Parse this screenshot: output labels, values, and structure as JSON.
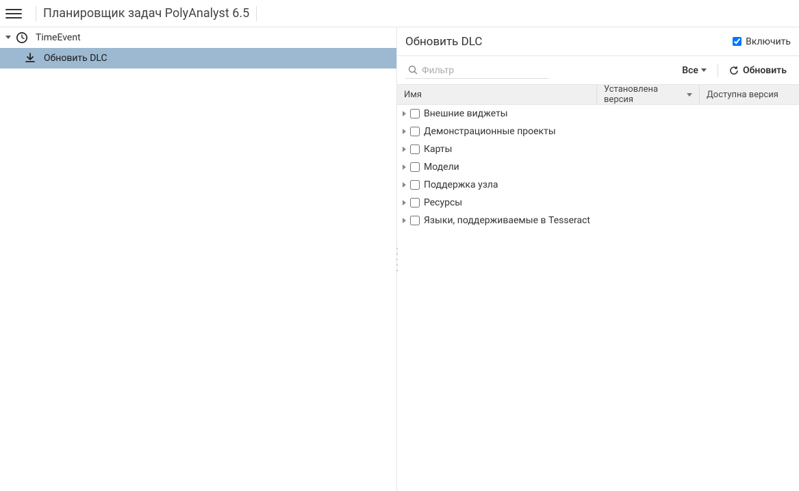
{
  "header": {
    "title": "Планировщик задач PolyAnalyst 6.5"
  },
  "tree": {
    "root_label": "TimeEvent",
    "child_label": "Обновить DLC"
  },
  "right": {
    "title": "Обновить DLC",
    "enable_label": "Включить",
    "filter_placeholder": "Фильтр",
    "all_label": "Все",
    "refresh_label": "Обновить",
    "columns": {
      "name": "Имя",
      "installed": "Установлена версия",
      "available": "Доступна версия"
    },
    "rows": [
      {
        "name": "Внешние виджеты"
      },
      {
        "name": "Демонстрационные проекты"
      },
      {
        "name": "Карты"
      },
      {
        "name": "Модели"
      },
      {
        "name": "Поддержка узла"
      },
      {
        "name": "Ресурсы"
      },
      {
        "name": "Языки, поддерживаемые в Tesseract"
      }
    ]
  }
}
